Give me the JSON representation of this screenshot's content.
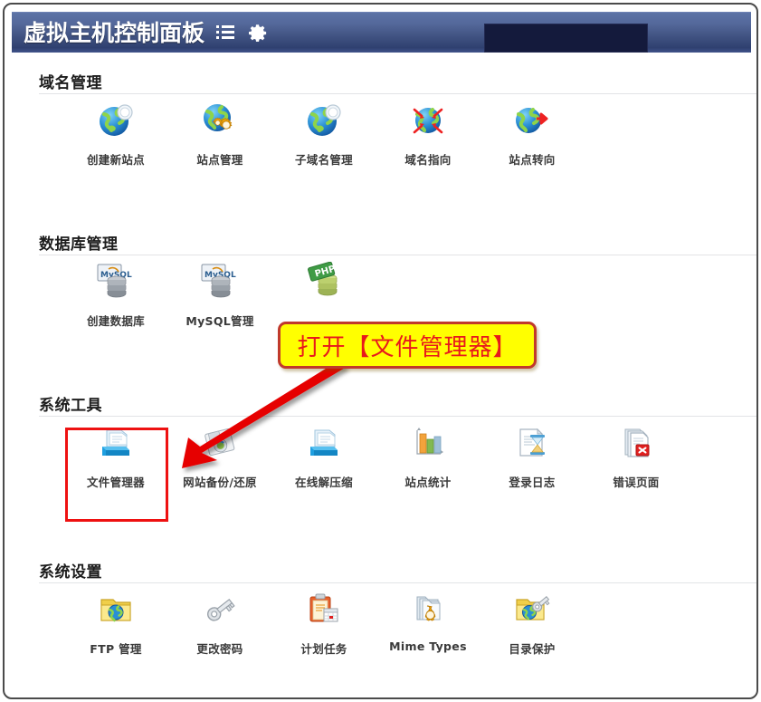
{
  "header": {
    "title": "虚拟主机控制面板",
    "menu_icon": "list-menu-icon",
    "settings_icon": "gear-icon",
    "masked_field_label": ""
  },
  "sections": [
    {
      "id": "domain-management",
      "title": "域名管理",
      "items": [
        {
          "label": "创建新站点",
          "icon": "globe-new-site-icon"
        },
        {
          "label": "站点管理",
          "icon": "globe-gears-icon"
        },
        {
          "label": "子域名管理",
          "icon": "globe-subdomain-icon"
        },
        {
          "label": "域名指向",
          "icon": "globe-arrows-icon"
        },
        {
          "label": "站点转向",
          "icon": "globe-redirect-icon"
        }
      ]
    },
    {
      "id": "database-management",
      "title": "数据库管理",
      "items": [
        {
          "label": "创建数据库",
          "icon": "mysql-database-icon"
        },
        {
          "label": "MySQL管理",
          "icon": "mysql-database-icon"
        },
        {
          "label": "",
          "icon": "php-database-icon"
        }
      ]
    },
    {
      "id": "system-tools",
      "title": "系统工具",
      "items": [
        {
          "label": "文件管理器",
          "icon": "file-manager-icon"
        },
        {
          "label": "网站备份/还原",
          "icon": "backup-restore-icon"
        },
        {
          "label": "在线解压缩",
          "icon": "archive-extract-icon"
        },
        {
          "label": "站点统计",
          "icon": "bar-chart-stats-icon"
        },
        {
          "label": "登录日志",
          "icon": "log-hourglass-icon"
        },
        {
          "label": "错误页面",
          "icon": "error-page-icon"
        }
      ]
    },
    {
      "id": "system-settings",
      "title": "系统设置",
      "items": [
        {
          "label": "FTP 管理",
          "icon": "ftp-folder-globe-icon"
        },
        {
          "label": "更改密码",
          "icon": "key-icon"
        },
        {
          "label": "计划任务",
          "icon": "clipboard-calendar-icon"
        },
        {
          "label": "Mime Types",
          "icon": "book-gear-icon"
        },
        {
          "label": "目录保护",
          "icon": "folder-protect-icon"
        }
      ]
    }
  ],
  "annotations": {
    "callout_text": "打开【文件管理器】",
    "callout_bg": "#ffff00",
    "callout_text_color": "#e8181c",
    "callout_border_color": "#c0392b",
    "highlight_target": "文件管理器",
    "highlight_color": "#ee1111",
    "arrow_color": "#e60000"
  }
}
